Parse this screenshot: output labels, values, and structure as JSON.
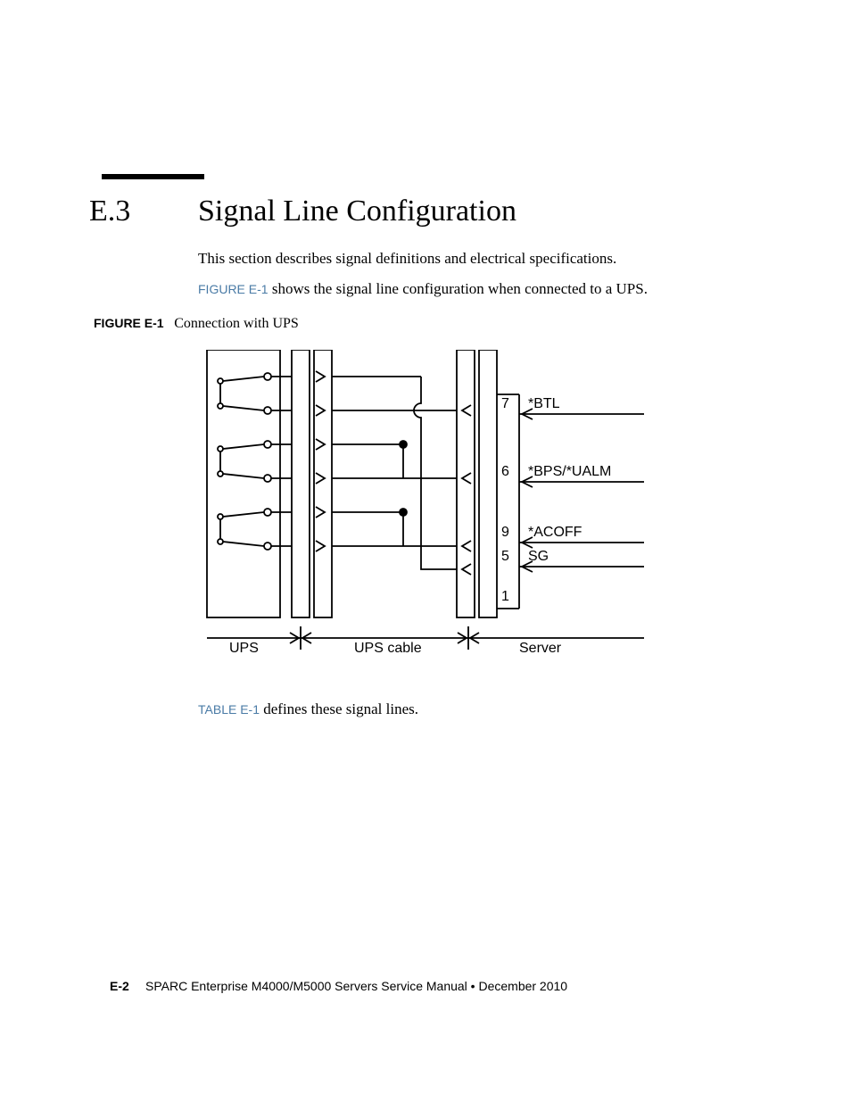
{
  "section": {
    "number": "E.3",
    "title": "Signal Line Configuration",
    "intro1": "This section describes signal definitions and electrical specifications.",
    "fig_ref": "FIGURE E-1",
    "intro2_rest": " shows the signal line configuration when connected to a UPS."
  },
  "figure": {
    "label_prefix": "FIGURE E-1",
    "caption": "Connection with UPS",
    "bottom_labels": {
      "ups": "UPS",
      "cable": "UPS cable",
      "server": "Server"
    },
    "signals": [
      {
        "pin": "7",
        "name": "*BTL"
      },
      {
        "pin": "6",
        "name": "*BPS/*UALM"
      },
      {
        "pin": "9",
        "name": "*ACOFF"
      },
      {
        "pin": "5",
        "name": "SG"
      },
      {
        "pin": "1",
        "name": ""
      }
    ]
  },
  "after_fig": {
    "table_ref": "TABLE E-1",
    "rest": " defines these signal lines."
  },
  "footer": {
    "page_num": "E-2",
    "text": "SPARC Enterprise M4000/M5000 Servers Service Manual  •  December 2010"
  }
}
